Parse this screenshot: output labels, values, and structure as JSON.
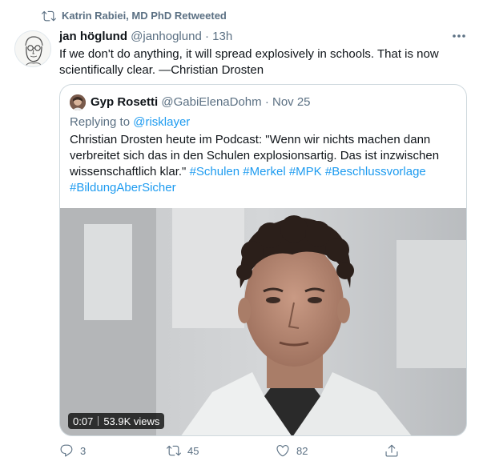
{
  "retweet": {
    "label": "Katrin Rabiei, MD PhD Retweeted",
    "icon": "retweet-icon"
  },
  "tweet": {
    "author_name": "jan höglund",
    "author_handle": "@janhoglund",
    "separator": "·",
    "time": "13h",
    "text": "If we don't do anything, it will spread explosively in schools. That is now scientifically clear. —Christian Drosten"
  },
  "quote": {
    "author_name": "Gyp Rosetti",
    "author_handle": "@GabiElenaDohm",
    "separator": "·",
    "date": "Nov 25",
    "reply_prefix": "Replying to",
    "reply_handle": "@risklayer",
    "text_plain": "Christian Drosten heute im Podcast: \"Wenn wir nichts machen dann verbreitet sich das in den Schulen explosionsartig. Das ist inzwischen wissenschaftlich klar.\"",
    "hashtags": [
      "#Schulen",
      "#Merkel",
      "#MPK",
      "#Beschlussvorlage",
      "#BildungAberSicher"
    ],
    "video": {
      "duration": "0:07",
      "views": "53.9K views"
    }
  },
  "actions": {
    "reply_count": "3",
    "retweet_count": "45",
    "like_count": "82"
  },
  "colors": {
    "secondary_text": "#5b7083",
    "link": "#1d9bf0",
    "border": "#cfd9de"
  }
}
